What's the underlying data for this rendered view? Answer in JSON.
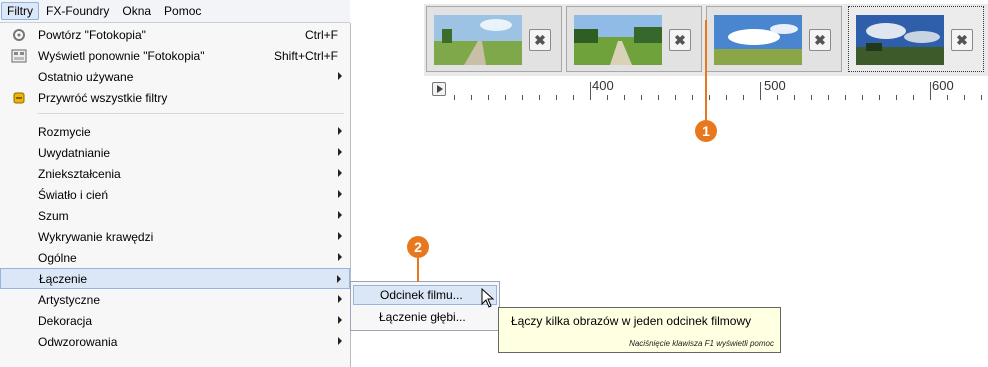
{
  "menubar": [
    "Filtry",
    "FX-Foundry",
    "Okna",
    "Pomoc"
  ],
  "menu_items": [
    {
      "label": "Powtórz \"Fotokopia\"",
      "shortcut": "Ctrl+F",
      "icon": "repeat-filter-icon"
    },
    {
      "label": "Wyświetl ponownie \"Fotokopia\"",
      "shortcut": "Shift+Ctrl+F",
      "icon": "reshow-filter-icon"
    },
    {
      "label": "Ostatnio używane",
      "submenu": true
    },
    {
      "label": "Przywróć wszystkie filtry",
      "icon": "reset-filters-icon"
    },
    {
      "label": "Rozmycie",
      "submenu": true
    },
    {
      "label": "Uwydatnianie",
      "submenu": true
    },
    {
      "label": "Zniekształcenia",
      "submenu": true
    },
    {
      "label": "Światło i cień",
      "submenu": true
    },
    {
      "label": "Szum",
      "submenu": true
    },
    {
      "label": "Wykrywanie krawędzi",
      "submenu": true
    },
    {
      "label": "Ogólne",
      "submenu": true
    },
    {
      "label": "Łączenie",
      "submenu": true,
      "highlighted": true
    },
    {
      "label": "Artystyczne",
      "submenu": true
    },
    {
      "label": "Dekoracja",
      "submenu": true
    },
    {
      "label": "Odwzorowania",
      "submenu": true
    }
  ],
  "submenu_items": [
    {
      "label": "Odcinek filmu...",
      "highlighted": true
    },
    {
      "label": "Łączenie głębi..."
    }
  ],
  "tooltip": {
    "text": "Łączy kilka obrazów w jeden odcinek filmowy",
    "hint": "Naciśnięcie klawisza F1 wyświetli pomoc"
  },
  "ruler_labels": [
    "400",
    "500",
    "600"
  ],
  "callouts": [
    "1",
    "2"
  ],
  "colors": {
    "callout": "#e8781e",
    "highlight": "#dbe7f6",
    "tooltip": "#ffffe1"
  },
  "frames": [
    "frame-1",
    "frame-2",
    "frame-3",
    "frame-4"
  ],
  "delete_glyph": "✖"
}
